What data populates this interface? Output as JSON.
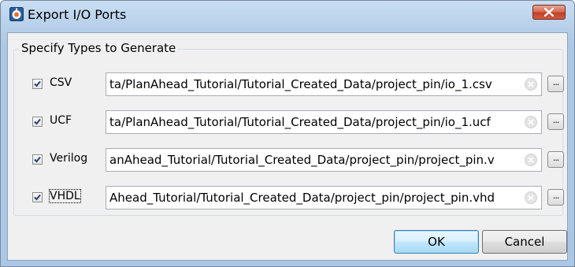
{
  "window": {
    "title": "Export I/O Ports",
    "app_icon": "app-icon",
    "close_icon": "close-x-icon"
  },
  "group": {
    "legend": "Specify Types to Generate"
  },
  "rows": [
    {
      "label": "CSV",
      "checked": true,
      "path": "ta/PlanAhead_Tutorial/Tutorial_Created_Data/project_pin/io_1.csv"
    },
    {
      "label": "UCF",
      "checked": true,
      "path": "ta/PlanAhead_Tutorial/Tutorial_Created_Data/project_pin/io_1.ucf"
    },
    {
      "label": "Verilog",
      "checked": true,
      "path": "anAhead_Tutorial/Tutorial_Created_Data/project_pin/project_pin.v"
    },
    {
      "label": "VHDL",
      "checked": true,
      "path": "Ahead_Tutorial/Tutorial_Created_Data/project_pin/project_pin.vhd"
    }
  ],
  "browse_label": "...",
  "buttons": {
    "ok": "OK",
    "cancel": "Cancel"
  },
  "colors": {
    "titlebar": "#b9d1ea",
    "close_button": "#c2412a",
    "ok_button": "#bee6fd"
  }
}
